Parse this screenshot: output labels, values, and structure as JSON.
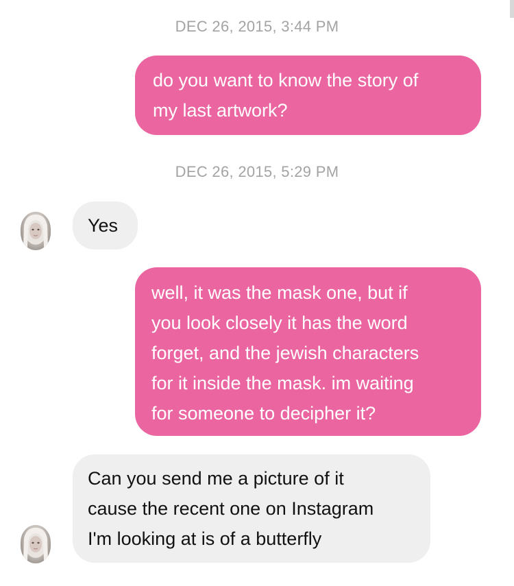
{
  "thread": {
    "messages": [
      {
        "type": "timestamp",
        "text": "DEC 26, 2015, 3:44 PM"
      },
      {
        "type": "sent",
        "lines": [
          "do you want to know the story of",
          "my last artwork?"
        ]
      },
      {
        "type": "timestamp",
        "text": "DEC 26, 2015, 5:29 PM"
      },
      {
        "type": "received",
        "lines": [
          "Yes"
        ],
        "avatar": "profile-photo"
      },
      {
        "type": "sent",
        "lines": [
          "well, it was the mask one, but if",
          "you look closely it has the word",
          "forget, and the jewish characters",
          "for it inside the mask. im waiting",
          "for someone to decipher it?"
        ]
      },
      {
        "type": "received",
        "lines": [
          "Can you send me a picture of it",
          "cause the recent one on Instagram",
          "I'm looking at is of a butterfly"
        ],
        "avatar": "profile-photo"
      }
    ]
  },
  "colors": {
    "sent_bubble": "#eb65a0",
    "received_bubble": "#efefef",
    "timestamp": "#a3a3a3"
  }
}
